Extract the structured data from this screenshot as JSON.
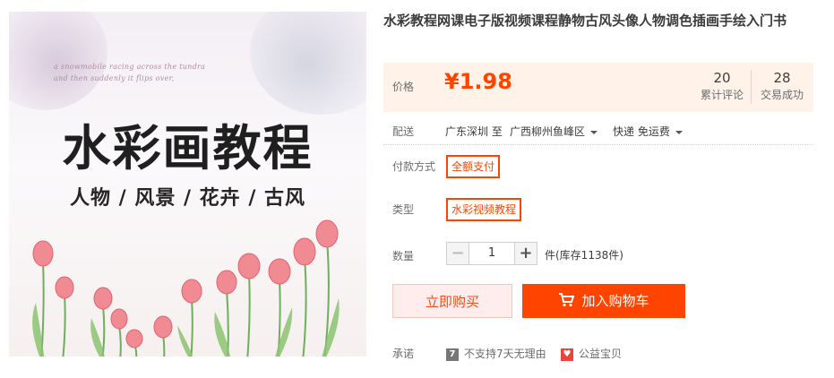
{
  "image": {
    "script_text_line1": "a snowmobile racing across the tundra",
    "script_text_line2": "and then suddenly it flips over,",
    "headline": "水彩画教程",
    "subtitle": "人物 / 风景 / 花卉 / 古风"
  },
  "product": {
    "title": "水彩教程网课电子版视频课程静物古风头像人物调色插画手绘入门书"
  },
  "price": {
    "label": "价格",
    "value": "¥1.98",
    "accent_color": "#ff4400"
  },
  "stats": {
    "reviews_count": "20",
    "reviews_label": "累计评论",
    "sales_count": "28",
    "sales_label": "交易成功"
  },
  "shipping": {
    "label": "配送",
    "from": "广东深圳 至",
    "to": "广西柳州鱼峰区",
    "method": "快递 免运费"
  },
  "payment": {
    "label": "付款方式",
    "option": "全额支付"
  },
  "type": {
    "label": "类型",
    "option": "水彩视频教程"
  },
  "quantity": {
    "label": "数量",
    "value": "1",
    "minus": "−",
    "plus": "+",
    "stock": "件(库存1138件)"
  },
  "buttons": {
    "buy_now": "立即购买",
    "add_to_cart": "加入购物车"
  },
  "promise": {
    "label": "承诺",
    "no_return": "不支持7天无理由",
    "charity": "公益宝贝",
    "no_return_icon": "7",
    "charity_icon": "heart-icon"
  }
}
